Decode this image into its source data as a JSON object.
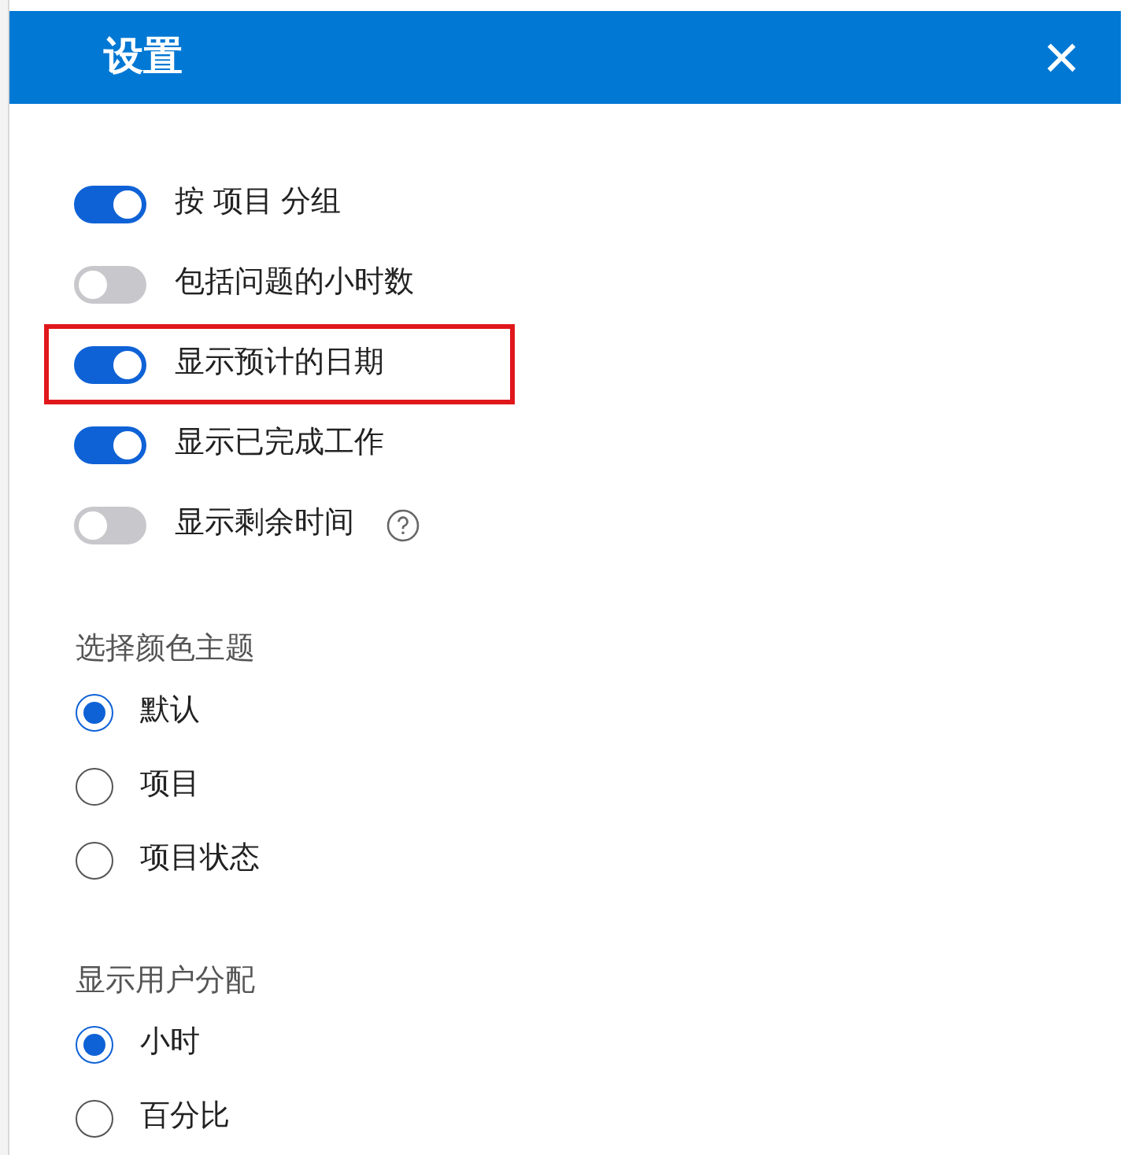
{
  "dialog": {
    "title": "设置",
    "close": "×"
  },
  "toggles": [
    {
      "label": "按 项目 分组",
      "on": true,
      "highlighted": false,
      "help": false
    },
    {
      "label": "包括问题的小时数",
      "on": false,
      "highlighted": false,
      "help": false
    },
    {
      "label": "显示预计的日期",
      "on": true,
      "highlighted": true,
      "help": false
    },
    {
      "label": "显示已完成工作",
      "on": true,
      "highlighted": false,
      "help": false
    },
    {
      "label": "显示剩余时间",
      "on": false,
      "highlighted": false,
      "help": true
    }
  ],
  "groups": [
    {
      "heading": "选择颜色主题",
      "options": [
        {
          "label": "默认",
          "selected": true
        },
        {
          "label": "项目",
          "selected": false
        },
        {
          "label": "项目状态",
          "selected": false
        }
      ]
    },
    {
      "heading": "显示用户分配",
      "options": [
        {
          "label": "小时",
          "selected": true
        },
        {
          "label": "百分比",
          "selected": false
        }
      ]
    }
  ]
}
